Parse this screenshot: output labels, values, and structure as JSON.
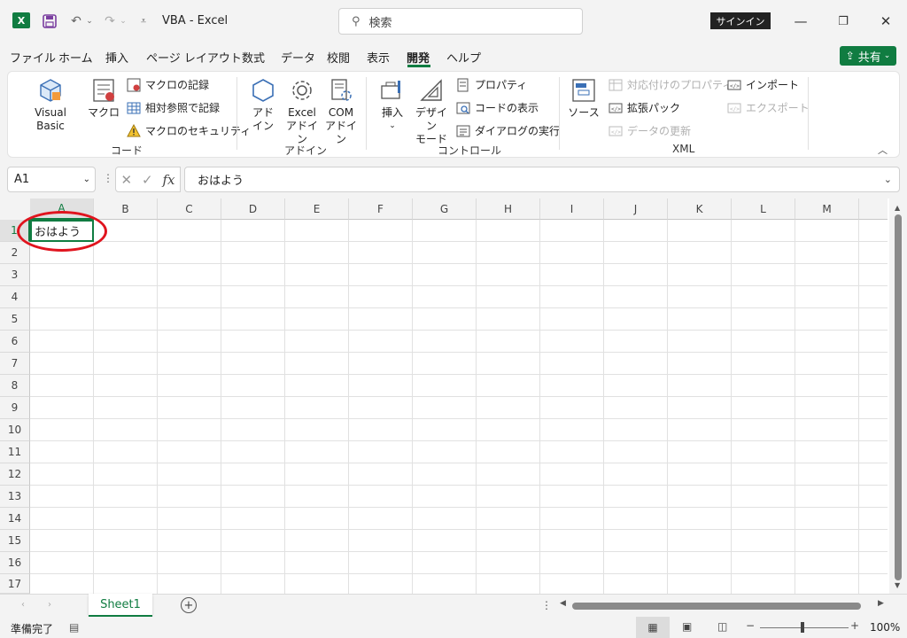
{
  "titlebar": {
    "app_logo": "X",
    "title": "VBA  -  Excel",
    "search_placeholder": "検索",
    "signin_label": "サインイン"
  },
  "menu": {
    "tabs": [
      "ファイル",
      "ホーム",
      "挿入",
      "ページ レイアウト",
      "数式",
      "データ",
      "校閲",
      "表示",
      "開発",
      "ヘルプ"
    ],
    "active_tab": "開発",
    "share_label": "共有"
  },
  "ribbon": {
    "code": {
      "label": "コード",
      "visual_basic": "Visual Basic",
      "macro": "マクロ",
      "record_macro": "マクロの記録",
      "relative_ref": "相対参照で記録",
      "macro_security": "マクロのセキュリティ"
    },
    "addins": {
      "label": "アドイン",
      "addin_1": "アド",
      "addin_2": "イン",
      "excel_addin_1": "Excel",
      "excel_addin_2": "アドイン",
      "com_addin_1": "COM",
      "com_addin_2": "アドイン"
    },
    "controls": {
      "label": "コントロール",
      "insert": "挿入",
      "design_mode_1": "デザイン",
      "design_mode_2": "モード",
      "properties": "プロパティ",
      "view_code": "コードの表示",
      "run_dialog": "ダイアログの実行"
    },
    "xml": {
      "label": "XML",
      "source": "ソース",
      "map_properties": "対応付けのプロパティ",
      "expansion_packs": "拡張パック",
      "refresh_data": "データの更新",
      "import": "インポート",
      "export": "エクスポート"
    }
  },
  "formula_bar": {
    "name_box": "A1",
    "fx": "fx",
    "value": "おはよう"
  },
  "sheet": {
    "columns": [
      "A",
      "B",
      "C",
      "D",
      "E",
      "F",
      "G",
      "H",
      "I",
      "J",
      "K",
      "L",
      "M"
    ],
    "rows": [
      "1",
      "2",
      "3",
      "4",
      "5",
      "6",
      "7",
      "8",
      "9",
      "10",
      "11",
      "12",
      "13",
      "14",
      "15",
      "16",
      "17"
    ],
    "selected_cell_value": "おはよう",
    "tab_name": "Sheet1"
  },
  "statusbar": {
    "ready": "準備完了",
    "zoom": "100%"
  },
  "colors": {
    "accent": "#107c41",
    "annotation": "#e0141e"
  }
}
